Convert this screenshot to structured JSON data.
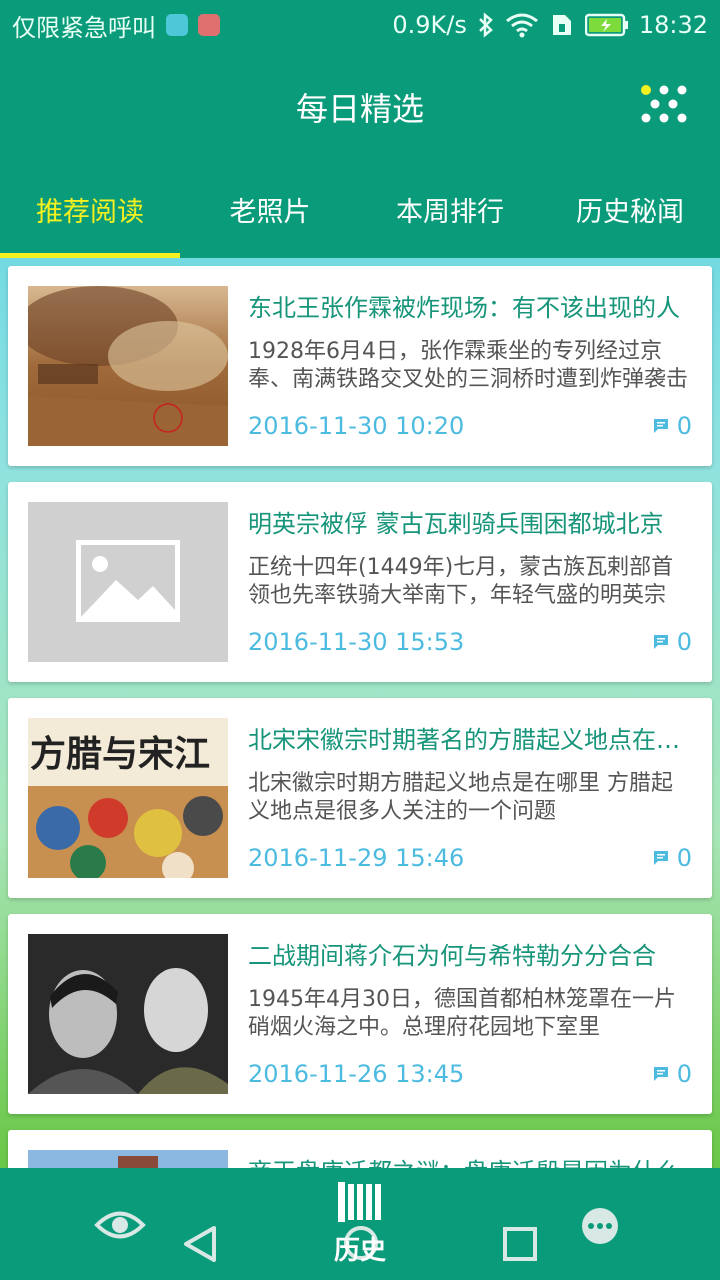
{
  "status_bar": {
    "left_text": "仅限紧急呼叫",
    "network_speed": "0.9K/s",
    "time": "18:32"
  },
  "header": {
    "title": "每日精选"
  },
  "tabs": [
    {
      "label": "推荐阅读",
      "active": true
    },
    {
      "label": "老照片",
      "active": false
    },
    {
      "label": "本周排行",
      "active": false
    },
    {
      "label": "历史秘闻",
      "active": false
    }
  ],
  "articles": [
    {
      "title": "东北王张作霖被炸现场：有不该出现的人",
      "summary": "1928年6月4日，张作霖乘坐的专列经过京奉、南满铁路交叉处的三洞桥时遭到炸弹袭击",
      "date": "2016-11-30 10:20",
      "comments": "0",
      "thumb": "sepia-explosion-photo"
    },
    {
      "title": "明英宗被俘 蒙古瓦剌骑兵围困都城北京",
      "summary": "正统十四年(1449年)七月，蒙古族瓦剌部首领也先率铁骑大举南下，年轻气盛的明英宗",
      "date": "2016-11-30 15:53",
      "comments": "0",
      "thumb": "image-placeholder-icon"
    },
    {
      "title": "北宋宋徽宗时期著名的方腊起义地点在哪里",
      "summary": "北宋徽宗时期方腊起义地点是在哪里 方腊起义地点是很多人关注的一个问题",
      "date": "2016-11-29 15:46",
      "comments": "0",
      "thumb": "battle-painting",
      "thumb_text": "方腊与宋江"
    },
    {
      "title": "二战期间蒋介石为何与希特勒分分合合",
      "summary": "1945年4月30日，德国首都柏林笼罩在一片硝烟火海之中。总理府花园地下室里",
      "date": "2016-11-26 13:45",
      "comments": "0",
      "thumb": "two-portraits-photo"
    },
    {
      "title": "商王盘庚迁都之谜：盘庚迁殷是因为什么",
      "thumb": "partial-photo"
    }
  ],
  "bottom_nav": {
    "history_label": "历史"
  },
  "colors": {
    "primary": "#0a9b7a",
    "active_tab": "#f5f020",
    "title_text": "#17957a",
    "meta_text": "#4dbbe0"
  }
}
